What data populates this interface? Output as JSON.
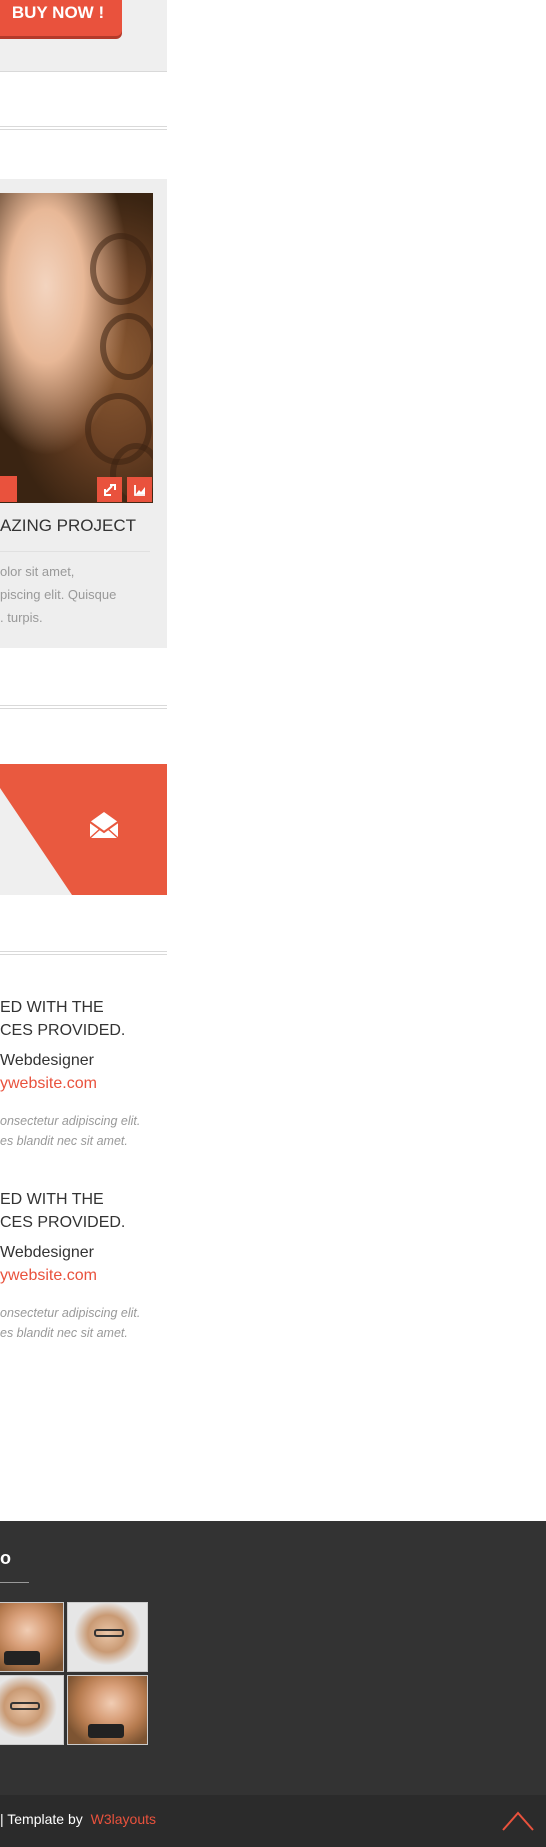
{
  "pricing": {
    "buy_label": "BUY NOW !"
  },
  "project": {
    "title": "AZING PROJECT",
    "text_lines": [
      "olor sit amet,",
      "piscing elit. Quisque",
      ". turpis."
    ],
    "icons": [
      "link-icon",
      "chart-icon"
    ]
  },
  "contact": {
    "icon": "envelope-icon",
    "colors": {
      "accent": "#e9593f",
      "background": "#efefef"
    }
  },
  "testimonials": [
    {
      "heading_lines": [
        "ED WITH THE",
        "CES PROVIDED."
      ],
      "role": "Webdesigner",
      "link": "ywebsite.com",
      "quote_lines": [
        "onsectetur adipiscing elit.",
        "es blandit nec sit amet."
      ]
    },
    {
      "heading_lines": [
        "ED WITH THE",
        "CES PROVIDED."
      ],
      "role": "Webdesigner",
      "link": "ywebsite.com",
      "quote_lines": [
        "onsectetur adipiscing elit.",
        "es blandit nec sit amet."
      ]
    }
  ],
  "footer": {
    "title": "o",
    "gallery": [
      "photo-woman-camera",
      "photo-man-glasses",
      "photo-man-glasses",
      "photo-woman-camera"
    ],
    "copyright": "| Template by",
    "credit": "W3layouts",
    "to_top_icon": "chevron-up-icon"
  }
}
